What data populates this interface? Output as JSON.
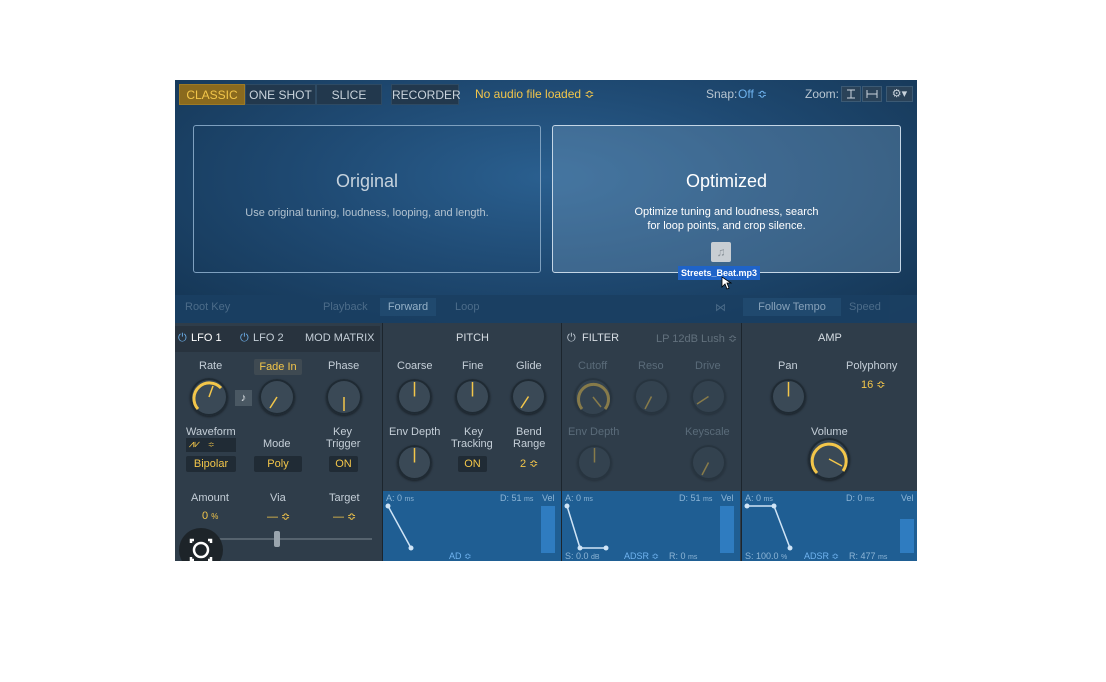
{
  "toolbar": {
    "mode_classic": "CLASSIC",
    "mode_one_shot": "ONE SHOT",
    "mode_slice": "SLICE",
    "recorder": "RECORDER",
    "audio_file": "No audio file loaded ≎",
    "snap_label": "Snap:",
    "snap_value": "Off ≎",
    "zoom_label": "Zoom:"
  },
  "cards": {
    "original_title": "Original",
    "original_desc": "Use original tuning, loudness, looping, and length.",
    "optimized_title": "Optimized",
    "optimized_desc_line1": "Optimize tuning and loudness, search",
    "optimized_desc_line2": "for loop points, and crop silence.",
    "dragged_file": "Streets_Beat.mp3"
  },
  "strip": {
    "root_key": "Root Key",
    "playback": "Playback",
    "forward": "Forward",
    "loop": "Loop",
    "follow_tempo": "Follow Tempo",
    "speed": "Speed"
  },
  "lfo": {
    "tab_lfo1": "LFO 1",
    "tab_lfo2": "LFO 2",
    "tab_mod_matrix": "MOD MATRIX",
    "rate": "Rate",
    "fade_in": "Fade In",
    "phase": "Phase",
    "waveform": "Waveform",
    "mode": "Mode",
    "key_trigger_l1": "Key",
    "key_trigger_l2": "Trigger",
    "waveform_value": "Bipolar",
    "mode_value": "Poly",
    "key_trigger_value": "ON",
    "amount": "Amount",
    "via": "Via",
    "target": "Target",
    "amount_value": "0",
    "amount_unit": "%",
    "via_value": "— ≎",
    "target_value": "— ≎"
  },
  "pitch": {
    "header": "PITCH",
    "coarse": "Coarse",
    "fine": "Fine",
    "glide": "Glide",
    "env_depth": "Env Depth",
    "key_tracking_l1": "Key",
    "key_tracking_l2": "Tracking",
    "bend_range_l1": "Bend",
    "bend_range_l2": "Range",
    "key_tracking_value": "ON",
    "bend_range_value": "2 ≎",
    "env_a": "A: 0",
    "env_a_unit": "ms",
    "env_d": "D: 51",
    "env_d_unit": "ms",
    "env_vel": "Vel",
    "env_type": "AD ≎"
  },
  "filter": {
    "header": "FILTER",
    "type": "LP 12dB Lush ≎",
    "cutoff": "Cutoff",
    "reso": "Reso",
    "drive": "Drive",
    "env_depth": "Env Depth",
    "keyscale": "Keyscale",
    "env_a": "A: 0",
    "env_a_unit": "ms",
    "env_d": "D: 51",
    "env_d_unit": "ms",
    "env_vel": "Vel",
    "env_s": "S: 0.0",
    "env_s_unit": "dB",
    "env_type": "ADSR ≎",
    "env_r": "R: 0",
    "env_r_unit": "ms"
  },
  "amp": {
    "header": "AMP",
    "pan": "Pan",
    "polyphony": "Polyphony",
    "polyphony_value": "16 ≎",
    "volume": "Volume",
    "env_a": "A: 0",
    "env_a_unit": "ms",
    "env_d": "D: 0",
    "env_d_unit": "ms",
    "env_vel": "Vel",
    "env_s": "S: 100.0",
    "env_s_unit": "%",
    "env_type": "ADSR ≎",
    "env_r": "R: 477",
    "env_r_unit": "ms"
  },
  "colors": {
    "accent": "#f3c64a",
    "panel": "#2f3d4a",
    "graph": "#1f5e93"
  }
}
